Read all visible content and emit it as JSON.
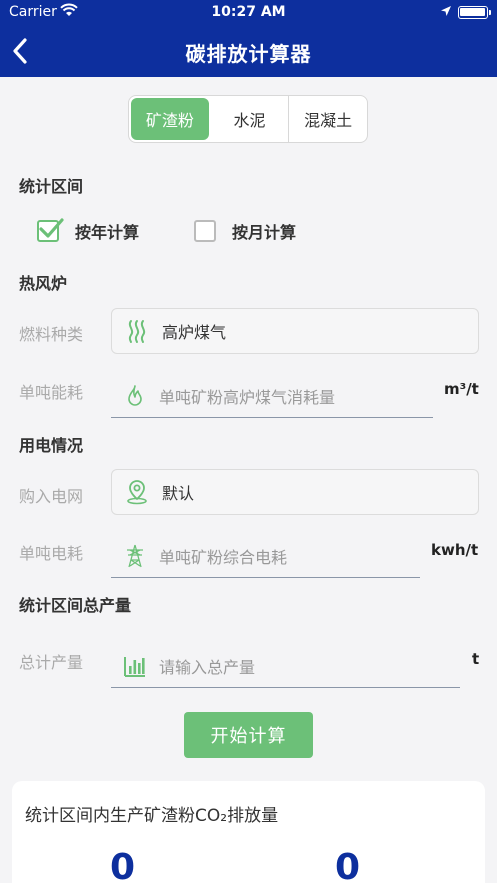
{
  "status": {
    "carrier": "Carrier",
    "time": "10:27 AM"
  },
  "header": {
    "title": "碳排放计算器"
  },
  "tabs": [
    {
      "label": "矿渣粉",
      "active": true
    },
    {
      "label": "水泥",
      "active": false
    },
    {
      "label": "混凝土",
      "active": false
    }
  ],
  "period": {
    "title": "统计区间",
    "yearly_label": "按年计算",
    "yearly_checked": true,
    "monthly_label": "按月计算",
    "monthly_checked": false
  },
  "hot_stove": {
    "title": "热风炉",
    "fuel_label": "燃料种类",
    "fuel_value": "高炉煤气",
    "consumption_label": "单吨能耗",
    "consumption_placeholder": "单吨矿粉高炉煤气消耗量",
    "consumption_unit": "m³/t"
  },
  "electricity": {
    "title": "用电情况",
    "grid_label": "购入电网",
    "grid_value": "默认",
    "consumption_label": "单吨电耗",
    "consumption_placeholder": "单吨矿粉综合电耗",
    "consumption_unit": "kwh/t"
  },
  "output": {
    "title": "统计区间总产量",
    "total_label": "总计产量",
    "total_placeholder": "请输入总产量",
    "total_unit": "t"
  },
  "actions": {
    "start_label": "开始计算"
  },
  "result": {
    "title": "统计区间内生产矿渣粉CO₂排放量",
    "value_left": "0",
    "value_right": "0"
  },
  "colors": {
    "primary": "#0d2f9e",
    "accent": "#6cc078"
  }
}
